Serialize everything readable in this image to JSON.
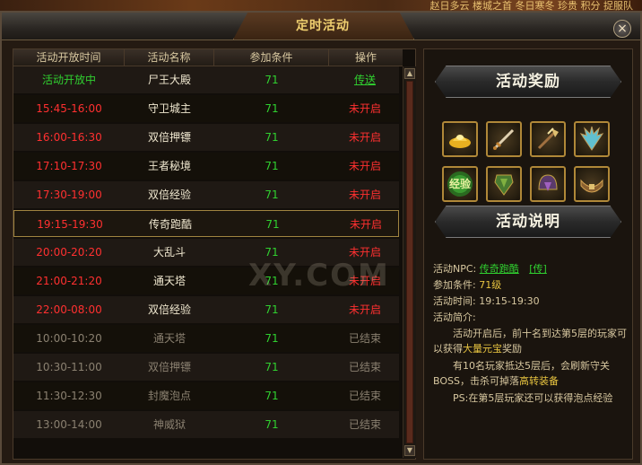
{
  "scene": {
    "top_text": "赵日多云 楼城之首 冬日寒冬 珍贵 积分 捉服队"
  },
  "window": {
    "title": "定时活动",
    "close_label": "×"
  },
  "table": {
    "headers": [
      "活动开放时间",
      "活动名称",
      "参加条件",
      "操作"
    ],
    "rows": [
      {
        "time": "活动开放中",
        "name": "尸王大殿",
        "req": "71",
        "op": "传送",
        "state": "open"
      },
      {
        "time": "15:45-16:00",
        "name": "守卫城主",
        "req": "71",
        "op": "未开启",
        "state": "pending"
      },
      {
        "time": "16:00-16:30",
        "name": "双倍押镖",
        "req": "71",
        "op": "未开启",
        "state": "pending"
      },
      {
        "time": "17:10-17:30",
        "name": "王者秘境",
        "req": "71",
        "op": "未开启",
        "state": "pending"
      },
      {
        "time": "17:30-19:00",
        "name": "双倍经验",
        "req": "71",
        "op": "未开启",
        "state": "pending"
      },
      {
        "time": "19:15-19:30",
        "name": "传奇跑酷",
        "req": "71",
        "op": "未开启",
        "state": "pending",
        "selected": true
      },
      {
        "time": "20:00-20:20",
        "name": "大乱斗",
        "req": "71",
        "op": "未开启",
        "state": "pending"
      },
      {
        "time": "21:00-21:20",
        "name": "通天塔",
        "req": "71",
        "op": "未开启",
        "state": "pending"
      },
      {
        "time": "22:00-08:00",
        "name": "双倍经验",
        "req": "71",
        "op": "未开启",
        "state": "pending"
      },
      {
        "time": "10:00-10:20",
        "name": "通天塔",
        "req": "71",
        "op": "已结束",
        "state": "ended"
      },
      {
        "time": "10:30-11:00",
        "name": "双倍押镖",
        "req": "71",
        "op": "已结束",
        "state": "ended"
      },
      {
        "time": "11:30-12:30",
        "name": "封魔泡点",
        "req": "71",
        "op": "已结束",
        "state": "ended"
      },
      {
        "time": "13:00-14:00",
        "name": "神威狱",
        "req": "71",
        "op": "已结束",
        "state": "ended"
      }
    ]
  },
  "colors": {
    "open_time": "#30d030",
    "open_name": "#f0e8d0",
    "open_op": "#30d030",
    "pending_time": "#ff3030",
    "pending_name": "#f0e8d0",
    "pending_op": "#ff3030",
    "ended_time": "#8a8070",
    "ended_name": "#8a8070",
    "ended_op": "#8a8070",
    "req": "#30d030"
  },
  "rewards": {
    "title": "活动奖励",
    "items": [
      {
        "icon": "gold-ingot-icon"
      },
      {
        "icon": "sword-icon"
      },
      {
        "icon": "axe-sword-icon"
      },
      {
        "icon": "wing-icon"
      },
      {
        "icon": "exp-icon",
        "label": "经验"
      },
      {
        "icon": "armor-icon"
      },
      {
        "icon": "helmet-icon"
      },
      {
        "icon": "belt-icon"
      }
    ]
  },
  "details": {
    "title": "活动说明",
    "npc_label": "活动NPC:",
    "npc_name": "传奇跑酷",
    "npc_link": "[传]",
    "req_label": "参加条件:",
    "req_value": "71级",
    "time_label": "活动时间:",
    "time_value": "19:15-19:30",
    "intro_label": "活动简介:",
    "intro_1a": "活动开启后，前十名到达第5层的玩家可以获得",
    "intro_1b": "大量元宝",
    "intro_1c": "奖励",
    "intro_2a": "有10名玩家抵达5层后，会刷新守关BOSS，击杀可掉落",
    "intro_2b": "高转装备",
    "intro_3": "PS:在第5层玩家还可以获得泡点经验"
  },
  "watermark": "XY.COM"
}
